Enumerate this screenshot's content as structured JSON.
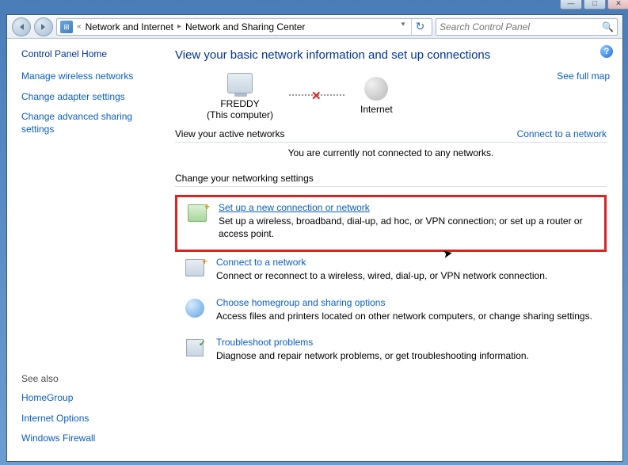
{
  "breadcrumb": {
    "sep": "«",
    "item1": "Network and Internet",
    "item2": "Network and Sharing Center"
  },
  "search": {
    "placeholder": "Search Control Panel"
  },
  "sidebar": {
    "home": "Control Panel Home",
    "links": {
      "a": "Manage wireless networks",
      "b": "Change adapter settings",
      "c": "Change advanced sharing settings"
    },
    "seealso_hd": "See also",
    "seealso": {
      "a": "HomeGroup",
      "b": "Internet Options",
      "c": "Windows Firewall"
    }
  },
  "main": {
    "title": "View your basic network information and set up connections",
    "fullmap": "See full map",
    "node_pc": "FREDDY",
    "node_pc_sub": "(This computer)",
    "node_net": "Internet",
    "active_hdr": "View your active networks",
    "connect_link": "Connect to a network",
    "active_msg": "You are currently not connected to any networks.",
    "change_hdr": "Change your networking settings",
    "opts": {
      "setup": {
        "title": "Set up a new connection or network",
        "desc": "Set up a wireless, broadband, dial-up, ad hoc, or VPN connection; or set up a router or access point."
      },
      "conn": {
        "title": "Connect to a network",
        "desc": "Connect or reconnect to a wireless, wired, dial-up, or VPN network connection."
      },
      "home": {
        "title": "Choose homegroup and sharing options",
        "desc": "Access files and printers located on other network computers, or change sharing settings."
      },
      "trouble": {
        "title": "Troubleshoot problems",
        "desc": "Diagnose and repair network problems, or get troubleshooting information."
      }
    }
  }
}
